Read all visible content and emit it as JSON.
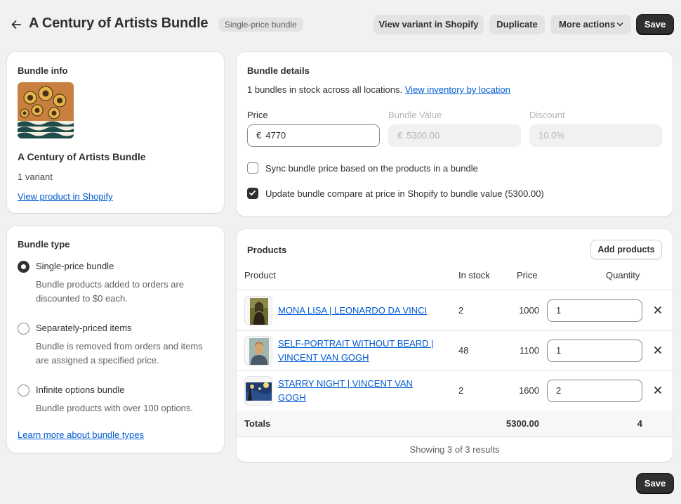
{
  "header": {
    "title": "A Century of Artists Bundle",
    "badge": "Single-price bundle",
    "view_variant": "View variant in Shopify",
    "duplicate": "Duplicate",
    "more_actions": "More actions",
    "save": "Save"
  },
  "info": {
    "heading": "Bundle info",
    "product_name": "A Century of Artists Bundle",
    "variants": "1 variant",
    "view_link": "View product in Shopify"
  },
  "bundle_type": {
    "heading": "Bundle type",
    "options": [
      {
        "label": "Single-price bundle",
        "desc": "Bundle products added to orders are discounted to $0 each.",
        "selected": true
      },
      {
        "label": "Separately-priced items",
        "desc": "Bundle is removed from orders and items are assigned a specified price.",
        "selected": false
      },
      {
        "label": "Infinite options bundle",
        "desc": "Bundle products with over 100 options.",
        "selected": false
      }
    ],
    "learn_link": "Learn more about bundle types"
  },
  "details": {
    "heading": "Bundle details",
    "stock_text": "1 bundles in stock across all locations.",
    "inventory_link": "View inventory by location",
    "price_label": "Price",
    "currency": "€",
    "price_value": "4770",
    "value_label": "Bundle Value",
    "value_value": "5300.00",
    "discount_label": "Discount",
    "discount_value": "10.0%",
    "sync_label": "Sync bundle price based on the products in a bundle",
    "sync_checked": false,
    "update_label": "Update bundle compare at price in Shopify to bundle value (5300.00)",
    "update_checked": true
  },
  "products": {
    "heading": "Products",
    "add_button": "Add products",
    "columns": {
      "product": "Product",
      "stock": "In stock",
      "price": "Price",
      "quantity": "Quantity"
    },
    "rows": [
      {
        "name": "MONA LISA | LEONARDO DA VINCI",
        "stock": "2",
        "price": "1000",
        "quantity": "1"
      },
      {
        "name": "SELF-PORTRAIT WITHOUT BEARD | VINCENT VAN GOGH",
        "stock": "48",
        "price": "1100",
        "quantity": "1"
      },
      {
        "name": "STARRY NIGHT | VINCENT VAN GOGH",
        "stock": "2",
        "price": "1600",
        "quantity": "2"
      }
    ],
    "totals_label": "Totals",
    "totals_price": "5300.00",
    "totals_quantity": "4",
    "showing": "Showing 3 of 3 results"
  }
}
